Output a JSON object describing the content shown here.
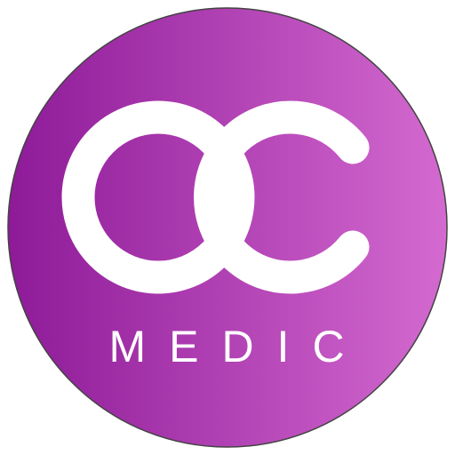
{
  "logo": {
    "letters": "OC",
    "wordmark": "MEDIC"
  },
  "colors": {
    "gradient_start": "#8e1a98",
    "gradient_end": "#d46ad0",
    "outline": "#444444",
    "glyph": "#ffffff"
  }
}
